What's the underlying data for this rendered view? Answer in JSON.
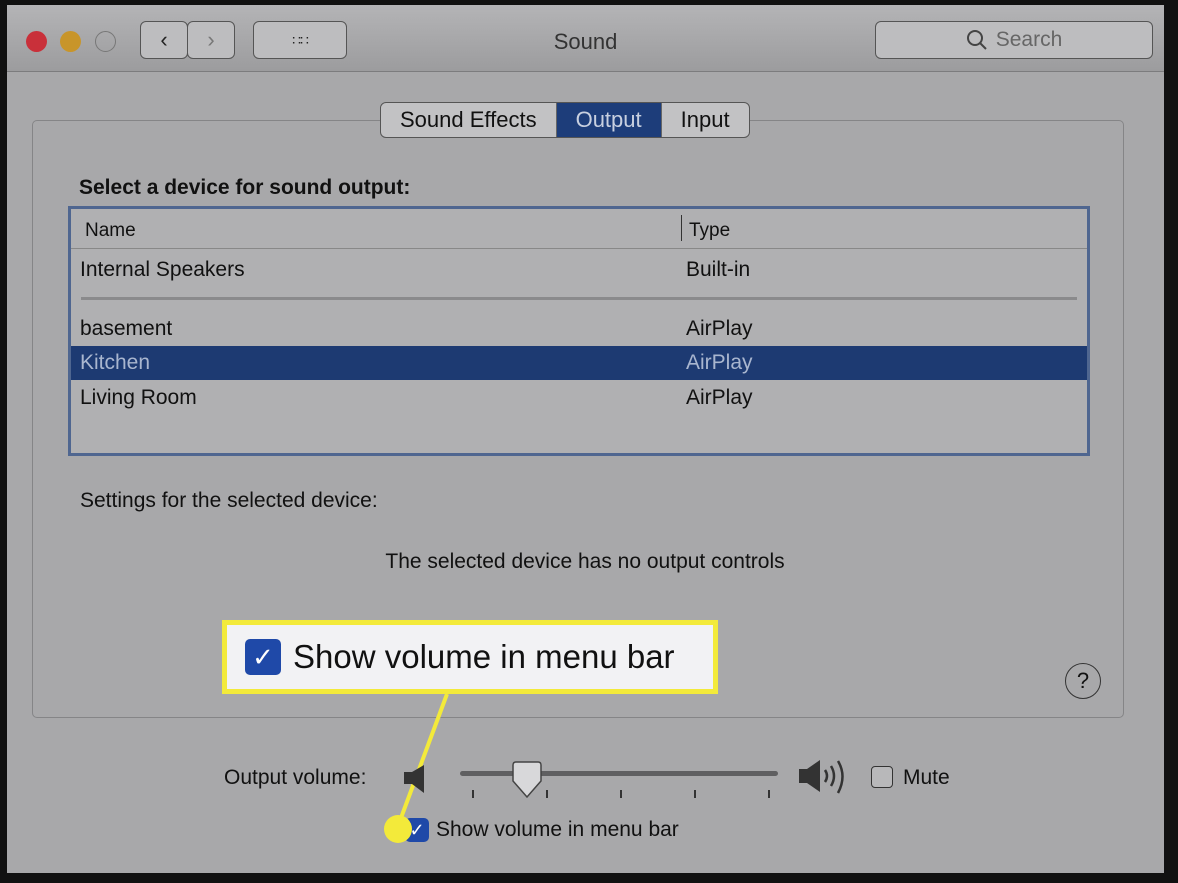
{
  "window": {
    "title": "Sound",
    "search_placeholder": "Search"
  },
  "tabs": [
    {
      "label": "Sound Effects",
      "selected": false
    },
    {
      "label": "Output",
      "selected": true
    },
    {
      "label": "Input",
      "selected": false
    }
  ],
  "output": {
    "heading": "Select a device for sound output:",
    "columns": [
      "Name",
      "Type"
    ],
    "devices": [
      {
        "name": "Internal Speakers",
        "type": "Built-in"
      },
      {
        "name": "basement",
        "type": "AirPlay"
      },
      {
        "name": "Kitchen",
        "type": "AirPlay",
        "selected": true
      },
      {
        "name": "Living Room",
        "type": "AirPlay"
      }
    ],
    "settings_label": "Settings for the selected device:",
    "no_controls": "The selected device has no output controls"
  },
  "callout": {
    "label": "Show volume in menu bar",
    "color": "#f3ea3a"
  },
  "volume": {
    "label": "Output volume:",
    "level_percent": 21,
    "mute_label": "Mute",
    "muted": false,
    "show_in_menu_bar_label": "Show volume in menu bar",
    "show_in_menu_bar": true
  },
  "colors": {
    "accent": "#1d3d7a",
    "close": "#d23a3d",
    "minimize": "#d39a2a"
  }
}
